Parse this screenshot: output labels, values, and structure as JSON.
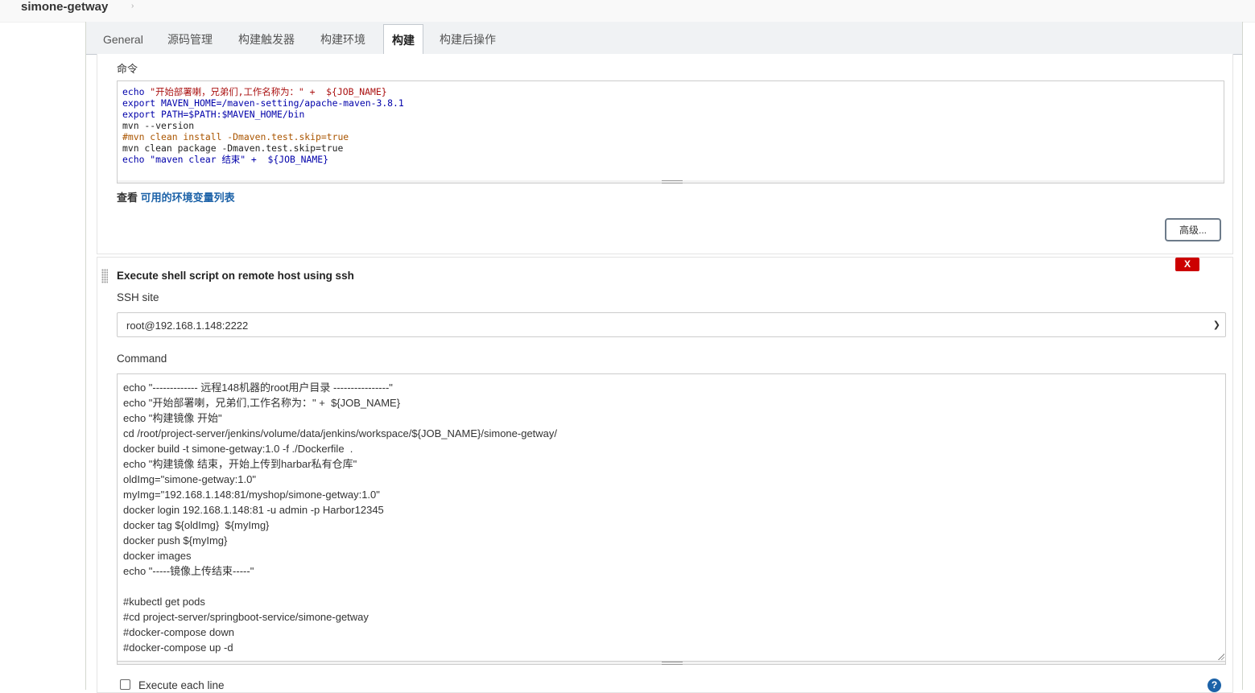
{
  "breadcrumb": {
    "job_name": "simone-getway",
    "arrow": "›"
  },
  "tabs": [
    {
      "label": "General"
    },
    {
      "label": "源码管理"
    },
    {
      "label": "构建触发器"
    },
    {
      "label": "构建环境"
    },
    {
      "label": "构建",
      "active": true
    },
    {
      "label": "构建后操作"
    }
  ],
  "maven_step": {
    "command_label": "命令",
    "code_lines": [
      "echo \"开始部署喇，兄弟们,工作名称为：\" +  ${JOB_NAME}",
      "export MAVEN_HOME=/maven-setting/apache-maven-3.8.1",
      "export PATH=$PATH:$MAVEN_HOME/bin",
      "mvn --version",
      "#mvn clean install -Dmaven.test.skip=true",
      "mvn clean package -Dmaven.test.skip=true",
      "echo \"maven clear 结束\" +  ${JOB_NAME}"
    ],
    "env_prefix": "查看 ",
    "env_link": "可用的环境变量列表",
    "advanced_button": "高级..."
  },
  "ssh_step": {
    "delete_label": "X",
    "title": "Execute shell script on remote host using ssh",
    "ssh_site_label": "SSH site",
    "ssh_site_value": "root@192.168.1.148:2222",
    "command_label": "Command",
    "command_lines": [
      "echo \"------------- 远程148机器的root用户目录 ----------------\"",
      "echo \"开始部署喇，兄弟们,工作名称为：\" +  ${JOB_NAME}",
      "echo \"构建镜像 开始\"",
      "cd /root/project-server/jenkins/volume/data/jenkins/workspace/${JOB_NAME}/simone-getway/",
      "docker build -t simone-getway:1.0 -f ./Dockerfile  .",
      "echo \"构建镜像 结束，开始上传到harbar私有仓库\"",
      "oldImg=\"simone-getway:1.0\"",
      "myImg=\"192.168.1.148:81/myshop/simone-getway:1.0\"",
      "docker login 192.168.1.148:81 -u admin -p Harbor12345",
      "docker tag ${oldImg}  ${myImg}",
      "docker push ${myImg}",
      "docker images",
      "echo \"-----镜像上传结束-----\"",
      "",
      "#kubectl get pods",
      "#cd project-server/springboot-service/simone-getway",
      "#docker-compose down",
      "#docker-compose up -d"
    ],
    "execute_each_line_label": "Execute each line",
    "help_label": "?"
  }
}
